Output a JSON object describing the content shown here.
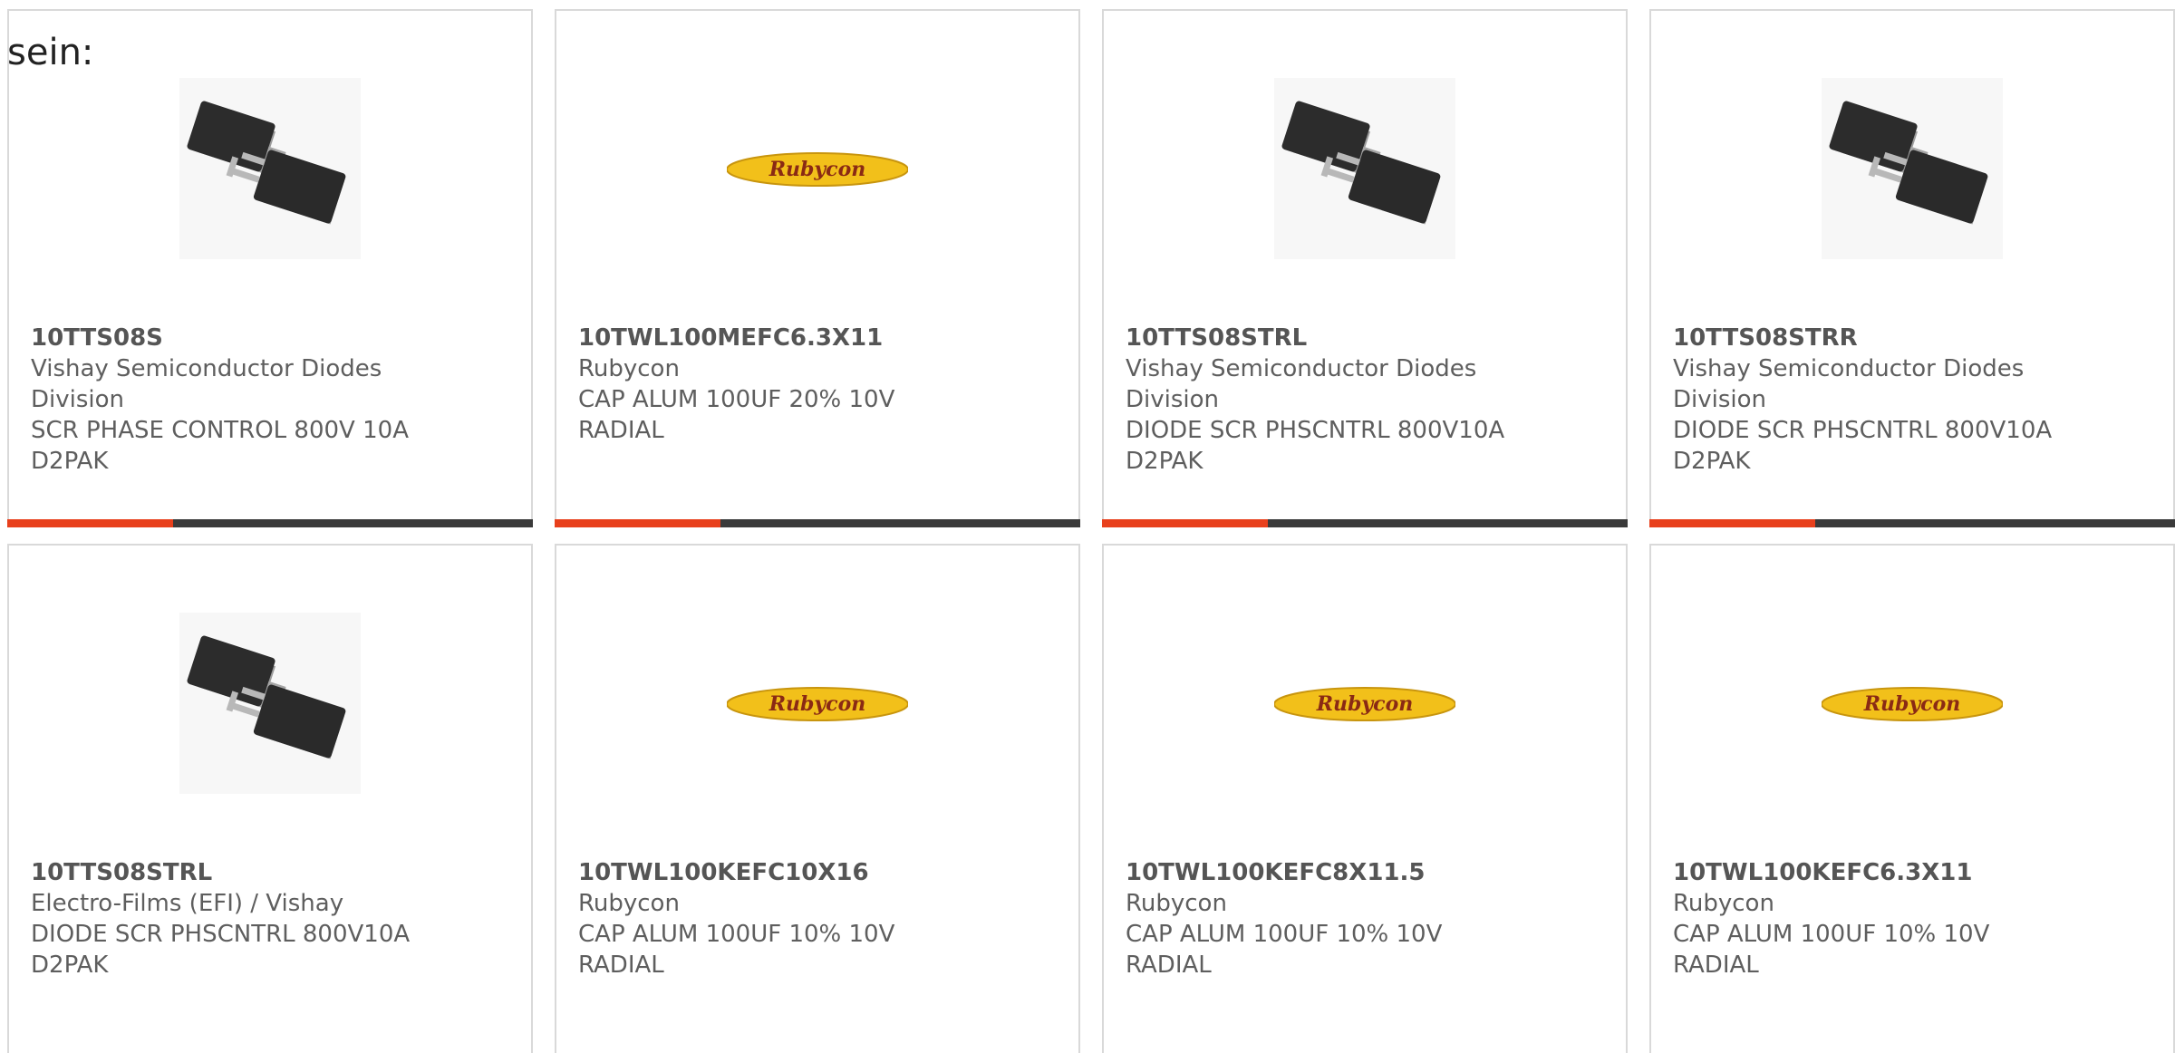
{
  "intro_text": "sein:",
  "colors": {
    "accent": "#e8401c",
    "bar": "#3a3a3a",
    "logo_yellow": "#f2c01a",
    "logo_text": "#8a2a14"
  },
  "products": [
    {
      "part_number": "10TTS08S",
      "manufacturer": "Vishay Semiconductor Diodes Division",
      "manufacturer_lines": [
        "Vishay Semiconductor Diodes",
        "Division"
      ],
      "description_lines": [
        "SCR PHASE CONTROL 800V 10A",
        "D2PAK"
      ],
      "image": "d2pak-package-icon"
    },
    {
      "part_number": "10TWL100MEFC6.3X11",
      "manufacturer": "Rubycon",
      "manufacturer_lines": [
        "Rubycon"
      ],
      "description_lines": [
        "CAP ALUM 100UF 20% 10V",
        "RADIAL"
      ],
      "image": "rubycon-logo",
      "logo_text": "Rubycon"
    },
    {
      "part_number": "10TTS08STRL",
      "manufacturer": "Vishay Semiconductor Diodes Division",
      "manufacturer_lines": [
        "Vishay Semiconductor Diodes",
        "Division"
      ],
      "description_lines": [
        "DIODE SCR PHSCNTRL 800V10A",
        "D2PAK"
      ],
      "image": "d2pak-package-icon"
    },
    {
      "part_number": "10TTS08STRR",
      "manufacturer": "Vishay Semiconductor Diodes Division",
      "manufacturer_lines": [
        "Vishay Semiconductor Diodes",
        "Division"
      ],
      "description_lines": [
        "DIODE SCR PHSCNTRL 800V10A",
        "D2PAK"
      ],
      "image": "d2pak-package-icon"
    },
    {
      "part_number": "10TTS08STRL",
      "manufacturer": "Electro-Films (EFI) / Vishay",
      "manufacturer_lines": [
        "Electro-Films (EFI) / Vishay"
      ],
      "description_lines": [
        "DIODE SCR PHSCNTRL 800V10A",
        "D2PAK"
      ],
      "image": "d2pak-package-icon"
    },
    {
      "part_number": "10TWL100KEFC10X16",
      "manufacturer": "Rubycon",
      "manufacturer_lines": [
        "Rubycon"
      ],
      "description_lines": [
        "CAP ALUM 100UF 10% 10V",
        "RADIAL"
      ],
      "image": "rubycon-logo",
      "logo_text": "Rubycon"
    },
    {
      "part_number": "10TWL100KEFC8X11.5",
      "manufacturer": "Rubycon",
      "manufacturer_lines": [
        "Rubycon"
      ],
      "description_lines": [
        "CAP ALUM 100UF 10% 10V",
        "RADIAL"
      ],
      "image": "rubycon-logo",
      "logo_text": "Rubycon"
    },
    {
      "part_number": "10TWL100KEFC6.3X11",
      "manufacturer": "Rubycon",
      "manufacturer_lines": [
        "Rubycon"
      ],
      "description_lines": [
        "CAP ALUM 100UF 10% 10V",
        "RADIAL"
      ],
      "image": "rubycon-logo",
      "logo_text": "Rubycon"
    }
  ]
}
